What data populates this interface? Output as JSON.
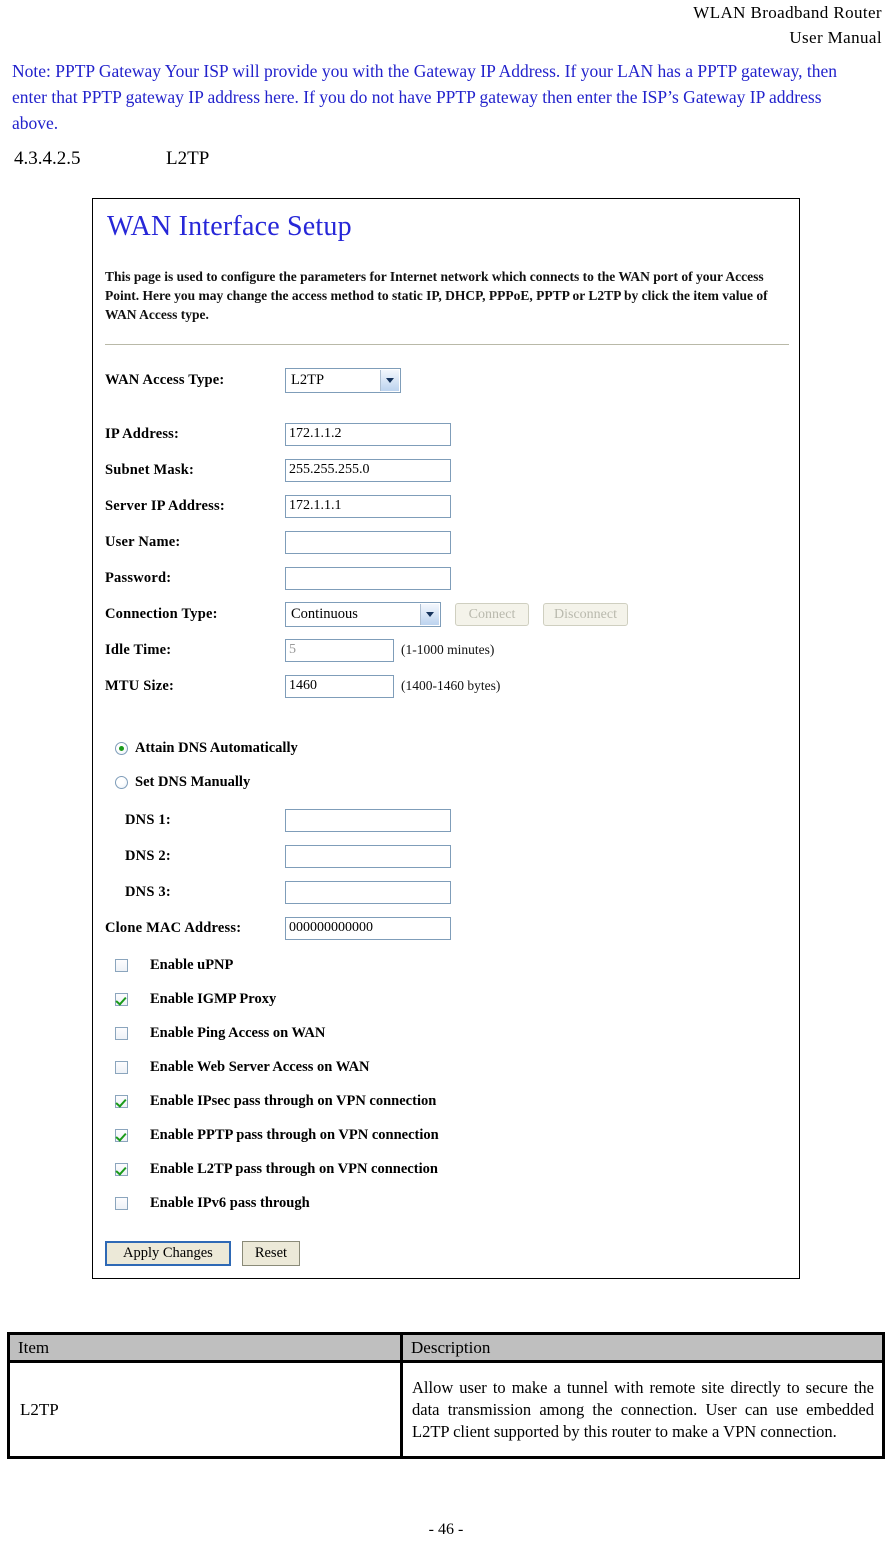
{
  "running_head": {
    "line1": "WLAN  Broadband  Router",
    "line2": "User  Manual"
  },
  "note": "Note: PPTP Gateway Your ISP will provide you with the Gateway IP Address. If your LAN has a PPTP gateway, then enter that PPTP gateway IP address here. If you do not have PPTP gateway then enter the ISP’s Gateway IP address above.",
  "section": {
    "number": "4.3.4.2.5",
    "title": "L2TP"
  },
  "panel": {
    "title": "WAN Interface Setup",
    "description": "This page is used to configure the parameters for Internet network which connects to the WAN port of your Access Point. Here you may change the access method to static IP, DHCP, PPPoE, PPTP or L2TP by click the item value of WAN Access type.",
    "fields": {
      "wan_access_type": {
        "label": "WAN Access Type:",
        "value": "L2TP"
      },
      "ip_address": {
        "label": "IP Address:",
        "value": "172.1.1.2"
      },
      "subnet_mask": {
        "label": "Subnet Mask:",
        "value": "255.255.255.0"
      },
      "server_ip_address": {
        "label": "Server IP Address:",
        "value": "172.1.1.1"
      },
      "user_name": {
        "label": "User Name:",
        "value": ""
      },
      "password": {
        "label": "Password:",
        "value": ""
      },
      "connection_type": {
        "label": "Connection Type:",
        "value": "Continuous"
      },
      "idle_time": {
        "label": "Idle Time:",
        "value": "5",
        "hint": "(1-1000 minutes)"
      },
      "mtu_size": {
        "label": "MTU Size:",
        "value": "1460",
        "hint": "(1400-1460 bytes)"
      },
      "dns1": {
        "label": "DNS 1:",
        "value": ""
      },
      "dns2": {
        "label": "DNS 2:",
        "value": ""
      },
      "dns3": {
        "label": "DNS 3:",
        "value": ""
      },
      "clone_mac_address": {
        "label": "Clone MAC Address:",
        "value": "000000000000"
      }
    },
    "buttons": {
      "connect": "Connect",
      "disconnect": "Disconnect",
      "apply_changes": "Apply Changes",
      "reset": "Reset"
    },
    "dns_mode": [
      {
        "label": "Attain DNS Automatically",
        "selected": true
      },
      {
        "label": "Set DNS Manually",
        "selected": false
      }
    ],
    "checkboxes": [
      {
        "label": "Enable uPNP",
        "checked": false
      },
      {
        "label": "Enable IGMP Proxy",
        "checked": true
      },
      {
        "label": "Enable Ping Access on WAN",
        "checked": false
      },
      {
        "label": "Enable Web Server Access on WAN",
        "checked": false
      },
      {
        "label": "Enable IPsec pass through on VPN connection",
        "checked": true
      },
      {
        "label": "Enable PPTP pass through on VPN connection",
        "checked": true
      },
      {
        "label": "Enable L2TP pass through on VPN connection",
        "checked": true
      },
      {
        "label": "Enable IPv6 pass through",
        "checked": false
      }
    ]
  },
  "table": {
    "headers": {
      "item": "Item",
      "description": "Description"
    },
    "rows": [
      {
        "item": "L2TP",
        "description": "Allow user to make a tunnel with remote site directly to secure the data transmission among the connection. User can use embedded L2TP client supported by this router to make a VPN connection."
      }
    ]
  },
  "footer": "- 46 -"
}
